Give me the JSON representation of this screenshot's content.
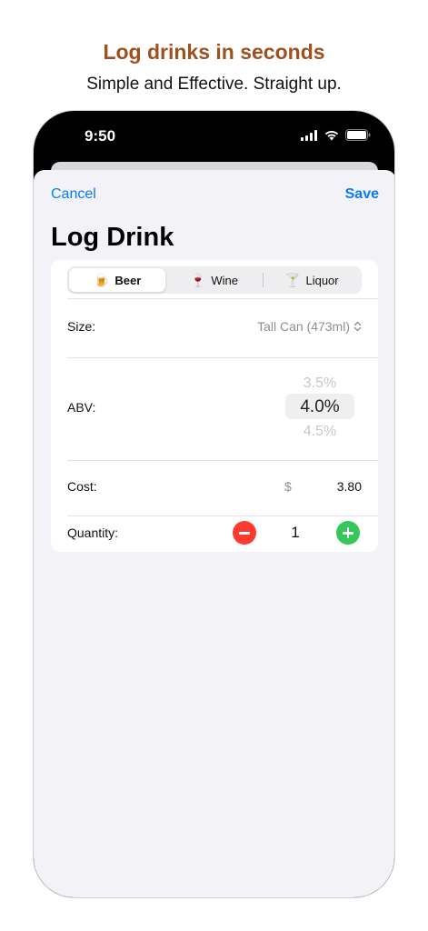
{
  "promo": {
    "headline": "Log drinks in seconds",
    "subhead": "Simple and Effective. Straight up."
  },
  "status_bar": {
    "time": "9:50",
    "icons": [
      "cellular-signal-icon",
      "wifi-icon",
      "battery-icon"
    ]
  },
  "nav": {
    "cancel_label": "Cancel",
    "save_label": "Save",
    "title": "Log Drink"
  },
  "drink_types": [
    {
      "label": "Beer",
      "icon": "🍺",
      "selected": true
    },
    {
      "label": "Wine",
      "icon": "🍷",
      "selected": false
    },
    {
      "label": "Liquor",
      "icon": "🍸",
      "selected": false
    }
  ],
  "form": {
    "size_label": "Size:",
    "size_value": "Tall Can (473ml)",
    "abv_label": "ABV:",
    "abv_options": [
      "3.5%",
      "4.0%",
      "4.5%"
    ],
    "abv_selected": "4.0%",
    "cost_label": "Cost:",
    "cost_currency": "$",
    "cost_value": "3.80",
    "quantity_label": "Quantity:",
    "quantity_value": "1"
  },
  "colors": {
    "accent": "#0a7aff",
    "headline": "#a0501f",
    "minus": "#ff3b30",
    "plus": "#34c759"
  }
}
